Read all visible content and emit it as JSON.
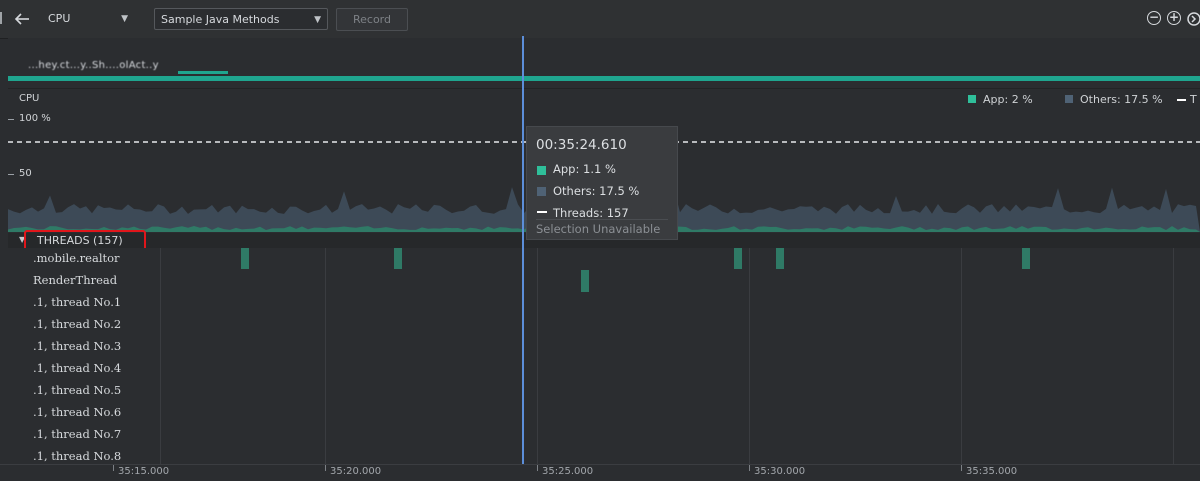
{
  "toolbar": {
    "monitor_select": "CPU",
    "profiling_select": "Sample Java Methods",
    "record_label": "Record",
    "back_icon": "back-arrow-icon",
    "zoom_out_icon": "zoom-out-icon",
    "zoom_in_icon": "zoom-in-icon",
    "jump_icon": "jump-to-live-icon"
  },
  "event": {
    "activity_text": "...hey.ct...y..Sh....olAct..y"
  },
  "cpu": {
    "label": "CPU",
    "y_100": "100 %",
    "y_50": "50",
    "legend": [
      {
        "label": "App: 2 %",
        "color": "#2fbf9a"
      },
      {
        "label": "Others: 17.5 %",
        "color": "#4f6275"
      },
      {
        "label": "T",
        "color": "#ffffff"
      }
    ]
  },
  "tooltip": {
    "time": "00:35:24.610",
    "app": "App: 1.1 %",
    "others": "Others: 17.5 %",
    "threads": "Threads: 157",
    "selection": "Selection Unavailable"
  },
  "threads": {
    "header": "THREADS (157)",
    "items": [
      ".mobile.realtor",
      "RenderThread",
      ".1, thread No.1",
      ".1, thread No.2",
      ".1, thread No.3",
      ".1, thread No.4",
      ".1, thread No.5",
      ".1, thread No.6",
      ".1, thread No.7",
      ".1, thread No.8"
    ]
  },
  "axis": {
    "ticks": [
      "35:15.000",
      "35:20.000",
      "35:25.000",
      "35:30.000",
      "35:35.000"
    ]
  },
  "colors": {
    "app": "#2fbf9a",
    "others": "#4f6275",
    "cursor": "#5c8ed9",
    "highlight_box": "#e0161b"
  }
}
